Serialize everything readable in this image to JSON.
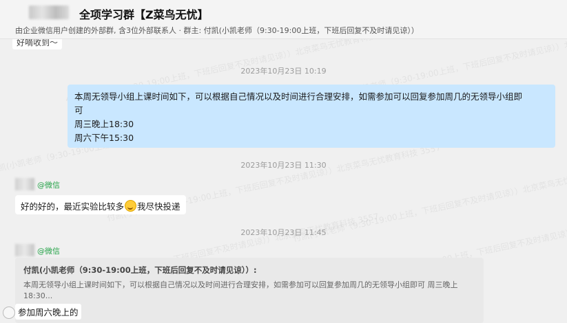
{
  "header": {
    "title": "全项学习群【Z菜鸟无忧】",
    "subtitle": "由企业微信用户创建的外部群, 含3位外部联系人 · 群主: 付凯(小凯老师（9:30-19:00上班，下班后回复不及时请见谅））"
  },
  "messages": {
    "cut_text": "好嘀收到～",
    "ts1": "2023年10月23日 10:19",
    "outgoing": {
      "line1": "本周无领导小组上课时间如下，可以根据自己情况以及时间进行合理安排，如需参加可以回复参加周几的无领导小组即",
      "line2": "可",
      "line3": "周三晚上18:30",
      "line4": "周六下午15:30"
    },
    "ts2": "2023年10月23日 11:30",
    "sender1_tag": "@微信",
    "incoming1_pre": "好的好的，最近实验比较多",
    "incoming1_post": "我尽快投递",
    "ts3": "2023年10月23日 11:45",
    "sender2_tag": "@微信",
    "quote": {
      "author": "付凯(小凯老师（9:30-19:00上班，下班后回复不及时请见谅））:",
      "body": "本周无领导小组上课时间如下，可以根据自己情况以及时间进行合理安排，如需参加可以回复参加周几的无领导小组即可 周三晚上18:30..."
    },
    "reply": "参加周六晚上的"
  },
  "watermark_text": "付凯(小凯老师（9:30-19:00上班，下班后回复不及时请见谅））北京菜鸟无忧教育科技 3557"
}
